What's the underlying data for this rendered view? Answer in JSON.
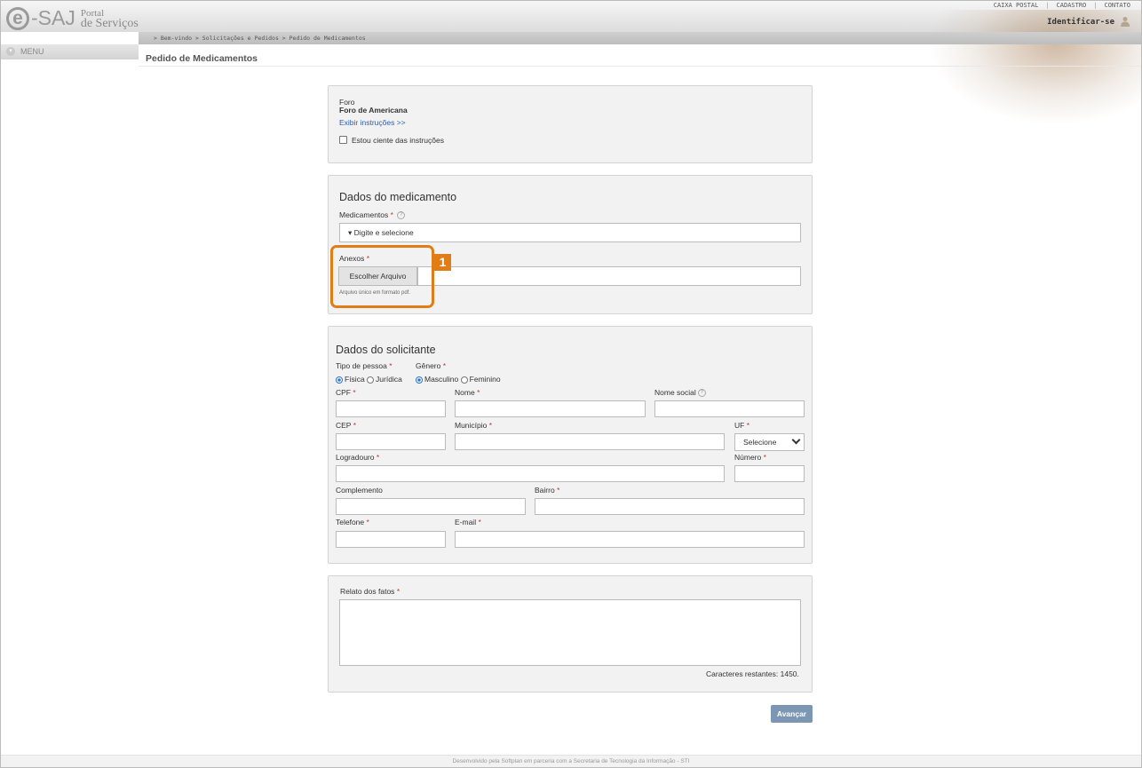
{
  "header": {
    "logo_e": "e",
    "logo_saj": "-SAJ",
    "logo_portal_line1": "Portal",
    "logo_portal_line2": "de Serviços",
    "links": [
      "CAIXA POSTAL",
      "CADASTRO",
      "CONTATO"
    ],
    "separator": "|",
    "identify": "Identificar-se",
    "breadcrumb": "> Bem-vindo > Solicitações e Pedidos > Pedido de Medicamentos",
    "menu": "MENU",
    "page_title": "Pedido de Medicamentos"
  },
  "foro": {
    "label": "Foro",
    "value": "Foro de Americana",
    "instructions_link": "Exibir instruções >>",
    "aware_label": "Estou ciente das instruções"
  },
  "medicamento": {
    "title": "Dados do medicamento",
    "medicamentos_label": "Medicamentos",
    "medicamentos_placeholder": "▾ Digite e selecione",
    "anexos_label": "Anexos",
    "file_button": "Escolher Arquivo",
    "file_hint": "Arquivo único em formato pdf.",
    "annotation": "1"
  },
  "solicitante": {
    "title": "Dados do solicitante",
    "tipo_pessoa_label": "Tipo de pessoa",
    "tipo_pessoa_options": [
      "Física",
      "Jurídica"
    ],
    "genero_label": "Gênero",
    "genero_options": [
      "Masculino",
      "Feminino"
    ],
    "cpf": "CPF",
    "nome": "Nome",
    "nome_social": "Nome social",
    "cep": "CEP",
    "municipio": "Município",
    "uf": "UF",
    "uf_selected": "Selecione",
    "logradouro": "Logradouro",
    "numero": "Número",
    "complemento": "Complemento",
    "bairro": "Bairro",
    "telefone": "Telefone",
    "email": "E-mail"
  },
  "relato": {
    "label": "Relato dos fatos",
    "counter": "Caracteres restantes: 1450."
  },
  "actions": {
    "next": "Avançar"
  },
  "required_mark": "*",
  "help_mark": "?",
  "footer": "Desenvolvido pela Softplan em parceria com a Secretaria de Tecnologia da Informação - STI",
  "colors": {
    "accent": "#e07d17",
    "button": "#7c97b3",
    "link": "#2a5db0"
  }
}
